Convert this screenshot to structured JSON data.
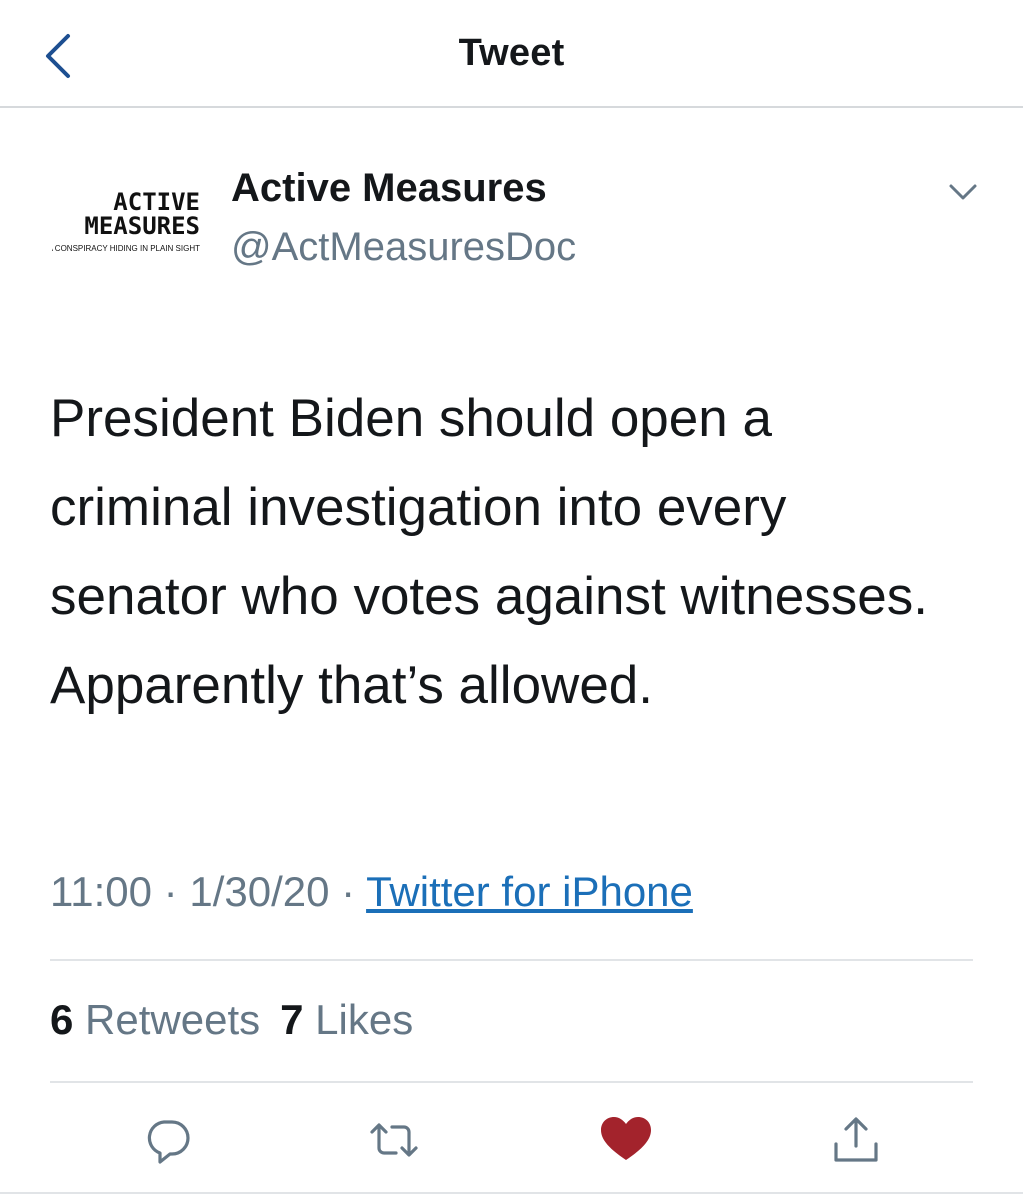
{
  "header": {
    "title": "Tweet",
    "back_icon": "chevron-left-icon"
  },
  "tweet": {
    "author": {
      "name": "Active Measures",
      "handle": "@ActMeasuresDoc",
      "avatar_logo": {
        "line1": "ACTIVE",
        "line2": "MEASURES",
        "tagline": "A CONSPIRACY HIDING IN PLAIN SIGHT"
      }
    },
    "text": "President Biden should open a criminal investigation into every senator who votes against witnesses. Apparently that’s allowed.",
    "time": "11:00",
    "date": "1/30/20",
    "separator": "·",
    "source": "Twitter for iPhone",
    "retweets_count": "6",
    "retweets_label": "Retweets",
    "likes_count": "7",
    "likes_label": "Likes"
  },
  "actions": [
    {
      "icon": "reply-icon"
    },
    {
      "icon": "retweet-icon"
    },
    {
      "icon": "heart-icon",
      "active": true
    },
    {
      "icon": "share-icon"
    }
  ],
  "colors": {
    "accent": "#1b6fb8",
    "back_chevron": "#1d4f91",
    "secondary_text": "#657786",
    "primary_text": "#14171a",
    "liked_heart": "#a3232c",
    "icon_gray": "#657786"
  }
}
